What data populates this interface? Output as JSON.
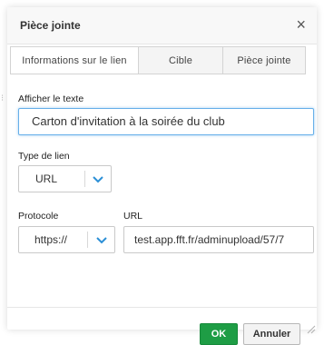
{
  "dialog": {
    "title": "Pièce jointe",
    "close_symbol": "×"
  },
  "tabs": [
    {
      "label": "Informations sur le lien",
      "active": true
    },
    {
      "label": "Cible",
      "active": false
    },
    {
      "label": "Pièce jointe",
      "active": false
    }
  ],
  "form": {
    "display_text": {
      "label": "Afficher le texte",
      "value": "Carton d'invitation à la soirée du club"
    },
    "link_type": {
      "label": "Type de lien",
      "value": "URL"
    },
    "protocol": {
      "label": "Protocole",
      "value": "https://"
    },
    "url": {
      "label": "URL",
      "value": "test.app.fft.fr/adminupload/57/7"
    }
  },
  "buttons": {
    "ok": "OK",
    "cancel": "Annuler"
  },
  "colors": {
    "accent_blue": "#2b8fd6",
    "ok_green": "#1e9d45"
  },
  "icons": {
    "close": "close-icon",
    "dropdown": "chevron-down-icon",
    "resize": "resize-grip-icon"
  }
}
